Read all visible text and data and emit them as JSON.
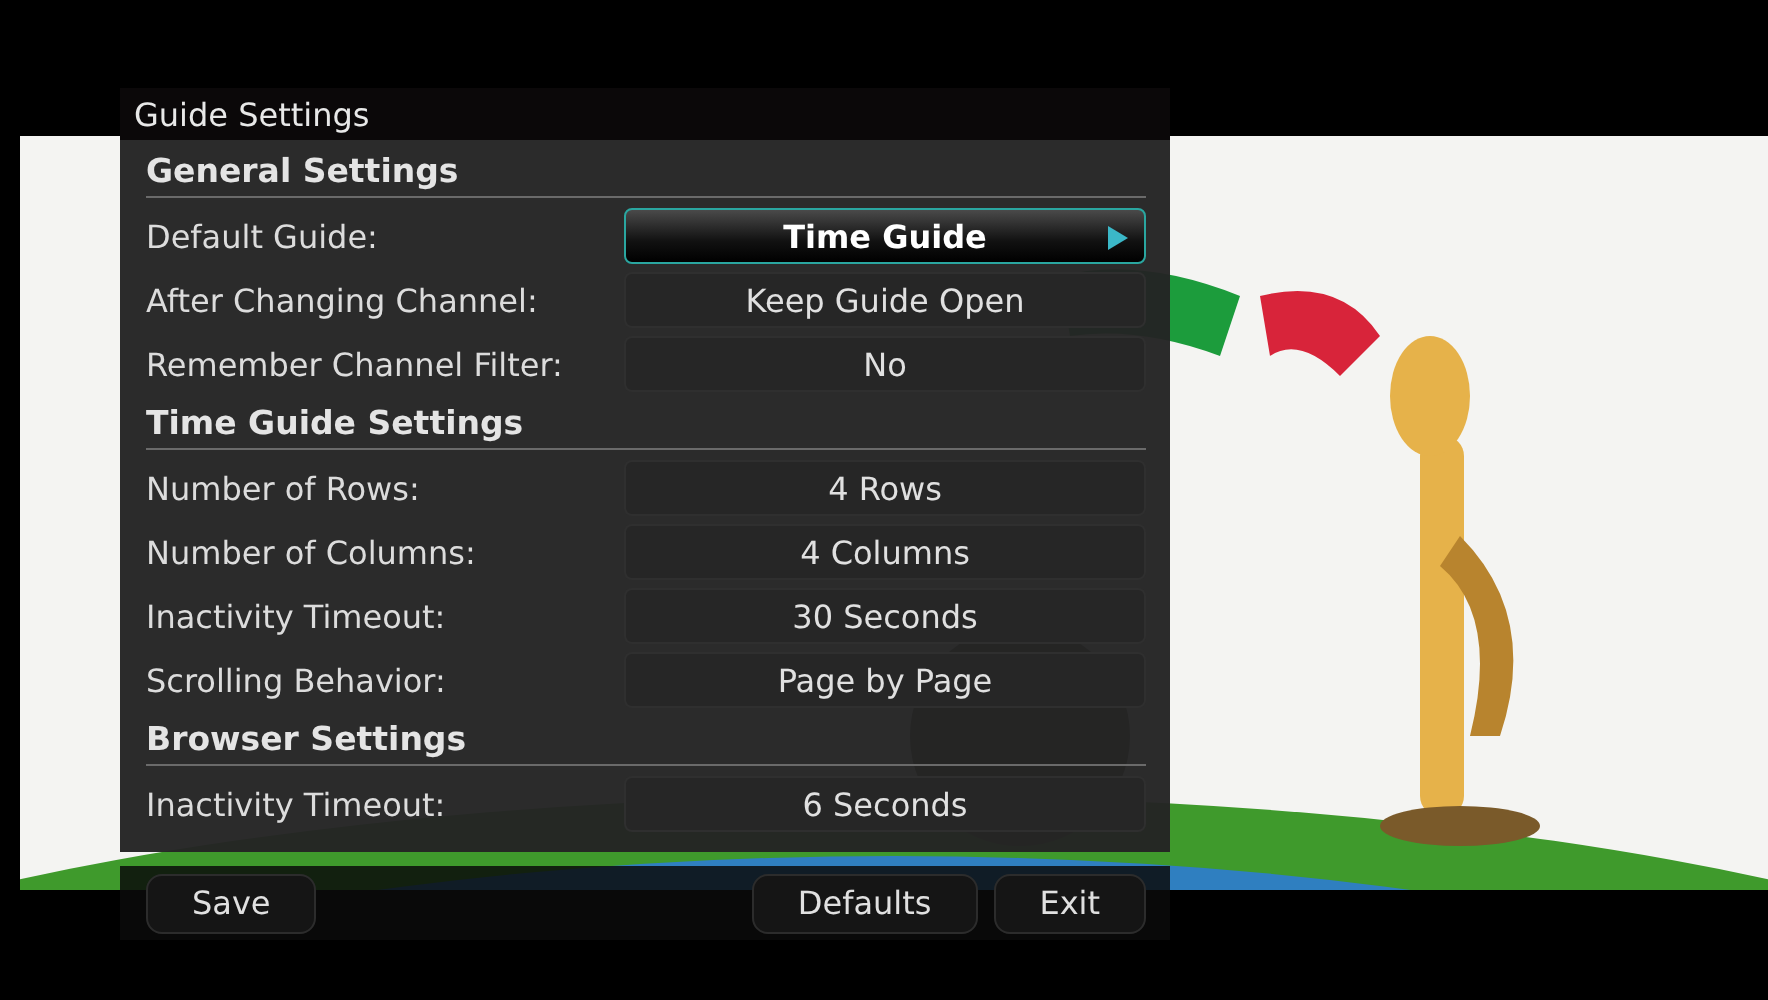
{
  "window": {
    "title": "Guide Settings"
  },
  "sections": [
    {
      "title": "General Settings",
      "settings": [
        {
          "label": "Default Guide:",
          "value": "Time Guide",
          "selected": true
        },
        {
          "label": "After Changing Channel:",
          "value": "Keep Guide Open",
          "selected": false
        },
        {
          "label": "Remember Channel Filter:",
          "value": "No",
          "selected": false
        }
      ]
    },
    {
      "title": "Time Guide Settings",
      "settings": [
        {
          "label": "Number of Rows:",
          "value": "4 Rows",
          "selected": false
        },
        {
          "label": "Number of Columns:",
          "value": "4 Columns",
          "selected": false
        },
        {
          "label": "Inactivity Timeout:",
          "value": "30 Seconds",
          "selected": false
        },
        {
          "label": "Scrolling Behavior:",
          "value": "Page by Page",
          "selected": false
        }
      ]
    },
    {
      "title": "Browser Settings",
      "settings": [
        {
          "label": "Inactivity Timeout:",
          "value": "6 Seconds",
          "selected": false
        }
      ]
    }
  ],
  "buttons_left": [
    "Save"
  ],
  "buttons_right": [
    "Defaults",
    "Exit"
  ]
}
